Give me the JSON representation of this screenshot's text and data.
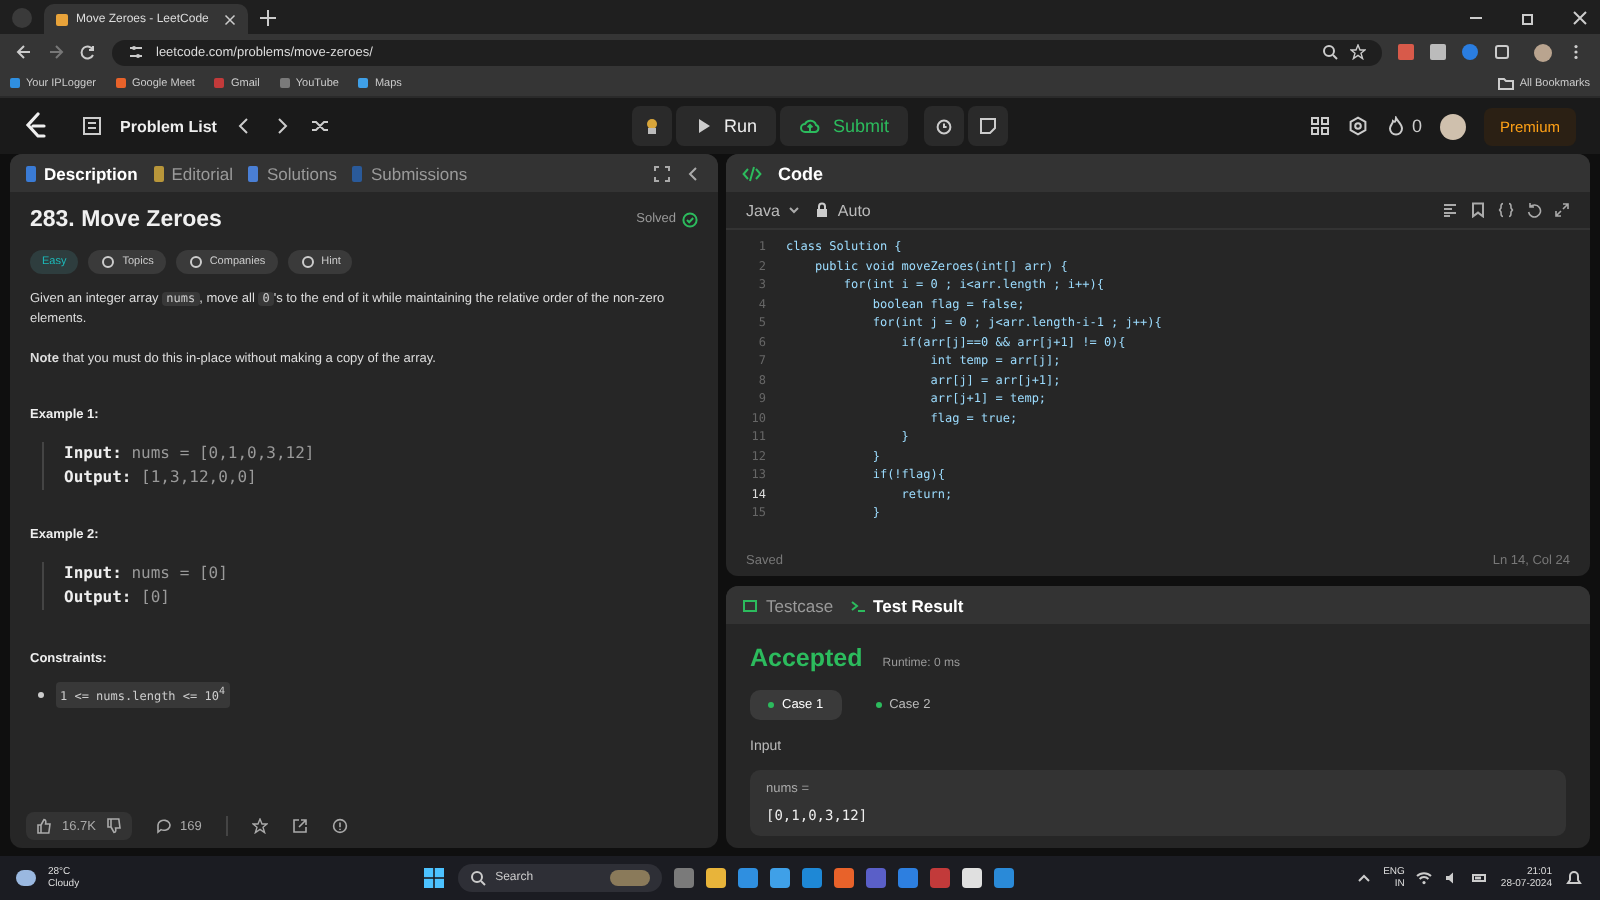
{
  "browser": {
    "tab_title": "Move Zeroes - LeetCode",
    "url": "leetcode.com/problems/move-zeroes/",
    "bookmarks": [
      "Your IPLogger",
      "Google Meet",
      "Gmail",
      "YouTube",
      "Maps"
    ],
    "all_bookmarks": "All Bookmarks"
  },
  "navbar": {
    "problem_list": "Problem List",
    "run": "Run",
    "submit": "Submit",
    "streak": "0",
    "premium": "Premium"
  },
  "left_tabs": [
    {
      "label": "Description",
      "selected": true
    },
    {
      "label": "Editorial",
      "selected": false
    },
    {
      "label": "Solutions",
      "selected": false
    },
    {
      "label": "Submissions",
      "selected": false
    }
  ],
  "problem": {
    "title": "283. Move Zeroes",
    "status": "Solved",
    "difficulty": "Easy",
    "tags": [
      "Topics",
      "Companies",
      "Hint"
    ],
    "description": [
      {
        "kind": "text",
        "text": "Given an integer array "
      },
      {
        "kind": "code",
        "text": "nums"
      },
      {
        "kind": "text",
        "text": ", move all "
      },
      {
        "kind": "code",
        "text": "0"
      },
      {
        "kind": "text",
        "text": "'s to the end of it while maintaining the relative order of the non-zero elements."
      }
    ],
    "note": "**Note** that you must do this in-place without making a copy of the array.",
    "examples": [
      {
        "title": "Example 1:",
        "input_label": "Input:",
        "input": "nums = [0,1,0,3,12]",
        "output_label": "Output:",
        "output": "[1,3,12,0,0]"
      },
      {
        "title": "Example 2:",
        "input_label": "Input:",
        "input": "nums = [0]",
        "output_label": "Output:",
        "output": "[0]"
      }
    ],
    "constraints_title": "Constraints:",
    "constraints": [
      "1 <= nums.length <= 10$^{4}$"
    ]
  },
  "footer": {
    "likes": "16.7K",
    "comments": "169"
  },
  "code_panel": {
    "title": "Code",
    "language": "Java",
    "mode": "Auto",
    "status": "Saved",
    "cursor": "Ln 14, Col 24",
    "lines": [
      {
        "number": "1",
        "text": "class Solution {",
        "current": false
      },
      {
        "number": "2",
        "text": "    public void moveZeroes(int[] arr) {",
        "current": false
      },
      {
        "number": "3",
        "text": "        for(int i = 0 ; i<arr.length ; i++){",
        "current": false
      },
      {
        "number": "4",
        "text": "            boolean flag = false;",
        "current": false
      },
      {
        "number": "5",
        "text": "            for(int j = 0 ; j<arr.length-i-1 ; j++){",
        "current": false
      },
      {
        "number": "6",
        "text": "                if(arr[j]==0 && arr[j+1] != 0){",
        "current": false
      },
      {
        "number": "7",
        "text": "                    int temp = arr[j];",
        "current": false
      },
      {
        "number": "8",
        "text": "                    arr[j] = arr[j+1];",
        "current": false
      },
      {
        "number": "9",
        "text": "                    arr[j+1] = temp;",
        "current": false
      },
      {
        "number": "10",
        "text": "                    flag = true;",
        "current": false
      },
      {
        "number": "11",
        "text": "                }",
        "current": false
      },
      {
        "number": "12",
        "text": "            }",
        "current": false
      },
      {
        "number": "13",
        "text": "            if(!flag){",
        "current": false
      },
      {
        "number": "14",
        "text": "                return;",
        "current": true
      },
      {
        "number": "15",
        "text": "            }",
        "current": false
      }
    ]
  },
  "result_tabs": [
    {
      "label": "Testcase",
      "selected": false
    },
    {
      "label": "Test Result",
      "selected": true
    }
  ],
  "result": {
    "verdict": "Accepted",
    "runtime": "Runtime: 0 ms",
    "cases": [
      {
        "label": "Case 1",
        "selected": true
      },
      {
        "label": "Case 2",
        "selected": false
      }
    ],
    "input_title": "Input",
    "param": "nums =",
    "value": "[0,1,0,3,12]"
  },
  "taskbar": {
    "temperature": "28°C",
    "weather": "Cloudy",
    "search": "Search",
    "language": "ENG",
    "region": "IN",
    "time": "21:01",
    "date": "28-07-2024"
  }
}
